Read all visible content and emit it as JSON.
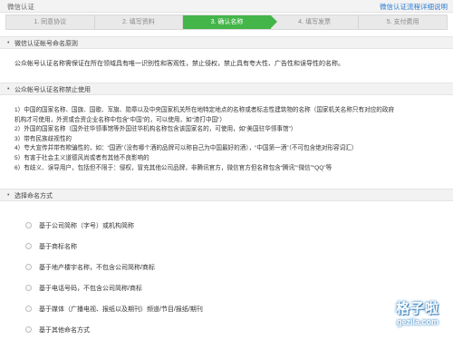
{
  "header": {
    "title": "微信认证",
    "help_link": "微信认证流程详细说明"
  },
  "steps": [
    {
      "label": "1. 同意协议",
      "active": false
    },
    {
      "label": "2. 填写资料",
      "active": false
    },
    {
      "label": "3. 确认名称",
      "active": true
    },
    {
      "label": "4. 填写发票",
      "active": false
    },
    {
      "label": "5. 支付费用",
      "active": false
    }
  ],
  "section1": {
    "heading": "微信认证帐号命名原则",
    "text": "公众帐号认证名称需保证在所在领域具有唯一识别性和客观性，禁止侵权，禁止具有夸大性、广告性和误导性的名称。"
  },
  "section2": {
    "heading": "公众帐号认证名称禁止使用",
    "rules": [
      "1）中国的国家名称、国旗、国歌、军旗、勋章以及中央国家机关所在地特定地点的名称或者标志性建筑物的名称（国家机关名称只有对应的政府",
      "机构才可使用，外资或合资企业名称中包含“中国”的，可以使用，如“渣打中国”）",
      "2）外国的国家名称（国外驻华领事馆等外国驻华机构名称包含该国家名的，可使用，如“美国驻华领事馆”）",
      "3）带有民族歧视性的",
      "4）夸大宣传并带有欺骗性的，如：“国酒”（没有哪个酒的品牌可以称自己为中国最好的酒），“中国第一酒”（不可包含绝对形容词汇）",
      "5）有害于社会主义道德风尚或者有其他不良影响的",
      "6）有歧义、误导用户，包括但不限于：侵权，冒充其他公司品牌，非腾讯官方，微信官方但名称包含“腾讯”“微信”“QQ”等"
    ]
  },
  "section3": {
    "heading": "选择命名方式",
    "options": [
      "基于公司简称（字号）或机构简称",
      "基于商标名称",
      "基于地产楼宇名称，不包含公司简称/商标",
      "基于电话号码，不包含公司简称/商标",
      "基于媒体（广播电视、报纸以及期刊）频道/节目/报纸/期刊",
      "基于其他命名方式"
    ]
  },
  "watermark": {
    "main": "格子啦",
    "sub": "gezila.com"
  },
  "colors": {
    "accent": "#44b549",
    "link": "#2b7bd1"
  }
}
